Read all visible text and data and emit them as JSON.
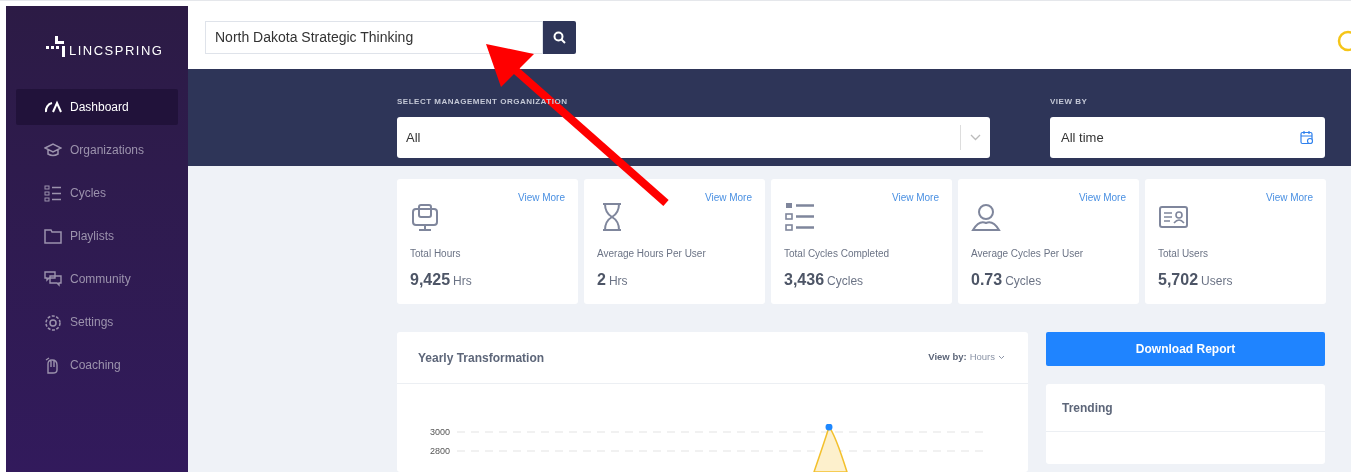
{
  "sidebar": {
    "logo": "LINCSPRING",
    "items": [
      {
        "label": "Dashboard",
        "kind": "gauge",
        "selected": true
      },
      {
        "label": "Organizations",
        "kind": "cap",
        "selected": false
      },
      {
        "label": "Cycles",
        "kind": "list",
        "selected": false
      },
      {
        "label": "Playlists",
        "kind": "folder",
        "selected": false
      },
      {
        "label": "Community",
        "kind": "chat",
        "selected": false
      },
      {
        "label": "Settings",
        "kind": "gear",
        "selected": false
      },
      {
        "label": "Coaching",
        "kind": "hand",
        "selected": false
      }
    ]
  },
  "search": {
    "value": "North Dakota Strategic Thinking"
  },
  "filters": {
    "organization": {
      "label": "SELECT MANAGEMENT ORGANIZATION",
      "value": "All"
    },
    "view_by": {
      "label": "VIEW BY",
      "value": "All time"
    }
  },
  "stats": [
    {
      "kind": "monitor",
      "link": "View More",
      "label": "Total Hours",
      "value": "9,425",
      "unit": "Hrs"
    },
    {
      "kind": "hourglass",
      "link": "View More",
      "label": "Average Hours Per User",
      "value": "2",
      "unit": "Hrs"
    },
    {
      "kind": "list",
      "link": "View More",
      "label": "Total Cycles Completed",
      "value": "3,436",
      "unit": "Cycles"
    },
    {
      "kind": "user",
      "link": "View More",
      "label": "Average Cycles Per User",
      "value": "0.73",
      "unit": "Cycles"
    },
    {
      "kind": "idcard",
      "link": "View More",
      "label": "Total Users",
      "value": "5,702",
      "unit": "Users"
    }
  ],
  "chart_card": {
    "title": "Yearly Transformation",
    "view_by_label": "View by:",
    "view_by_value": "Hours",
    "y_labels": [
      "3000",
      "2800"
    ]
  },
  "download_button": "Download Report",
  "trending": {
    "title": "Trending"
  }
}
